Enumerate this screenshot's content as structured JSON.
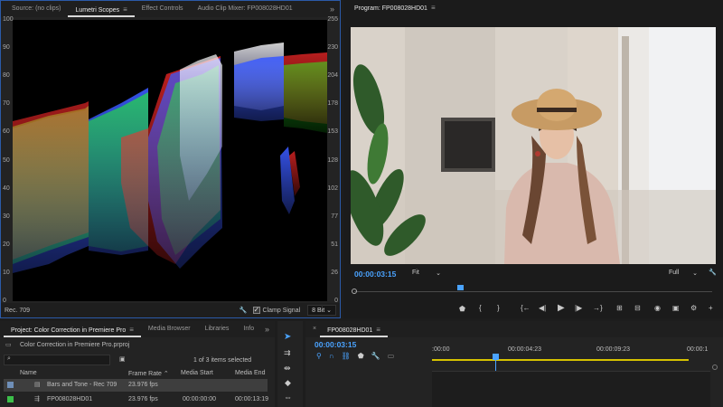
{
  "source_panel": {
    "tabs": [
      "Source: (no clips)",
      "Lumetri Scopes",
      "Effect Controls",
      "Audio Clip Mixer: FP008028HD01"
    ],
    "active_tab": "Lumetri Scopes",
    "menu_icon": "hamburger-icon",
    "more_icon": "double-chevron-right-icon",
    "left_ticks": [
      "100",
      "90",
      "80",
      "70",
      "60",
      "50",
      "40",
      "30",
      "20",
      "10",
      "0"
    ],
    "right_ticks": [
      "255",
      "230",
      "204",
      "178",
      "153",
      "128",
      "102",
      "77",
      "51",
      "26",
      "0"
    ],
    "footer": {
      "colorspace": "Rec. 709",
      "clamp_label": "Clamp Signal",
      "bit_depth": "8 Bit"
    },
    "scope_colors": {
      "red": "#ff2a2a",
      "green": "#22ff22",
      "blue": "#3a5aff"
    }
  },
  "program_panel": {
    "title": "Program: FP008028HD01",
    "timecode": "00:00:03:15",
    "zoom": "Fit",
    "quality": "Full",
    "accent": "#4aa3ff"
  },
  "project_panel": {
    "tabs": [
      "Project: Color Correction in Premiere Pro",
      "Media Browser",
      "Libraries",
      "Info"
    ],
    "file_name": "Color Correction in Premiere Pro.prproj",
    "search_placeholder": "",
    "items_selected": "1 of 3 items selected",
    "columns": [
      "Name",
      "Frame Rate",
      "Media Start",
      "Media End"
    ],
    "rows": [
      {
        "color": "#6f8fb8",
        "name": "Bars and Tone - Rec 709",
        "frame_rate": "23.976 fps",
        "media_start": "",
        "media_end": ""
      },
      {
        "color": "#3cbf4a",
        "name": "FP008028HD01",
        "frame_rate": "23.976 fps",
        "media_start": "00:00:00:00",
        "media_end": "00:00:13:19"
      }
    ]
  },
  "timeline_panel": {
    "sequence_name": "FP008028HD01",
    "timecode": "00:00:03:15",
    "ruler_labels": [
      ":00:00",
      "00:00:04:23",
      "00:00:09:23",
      "00:00:1"
    ]
  }
}
